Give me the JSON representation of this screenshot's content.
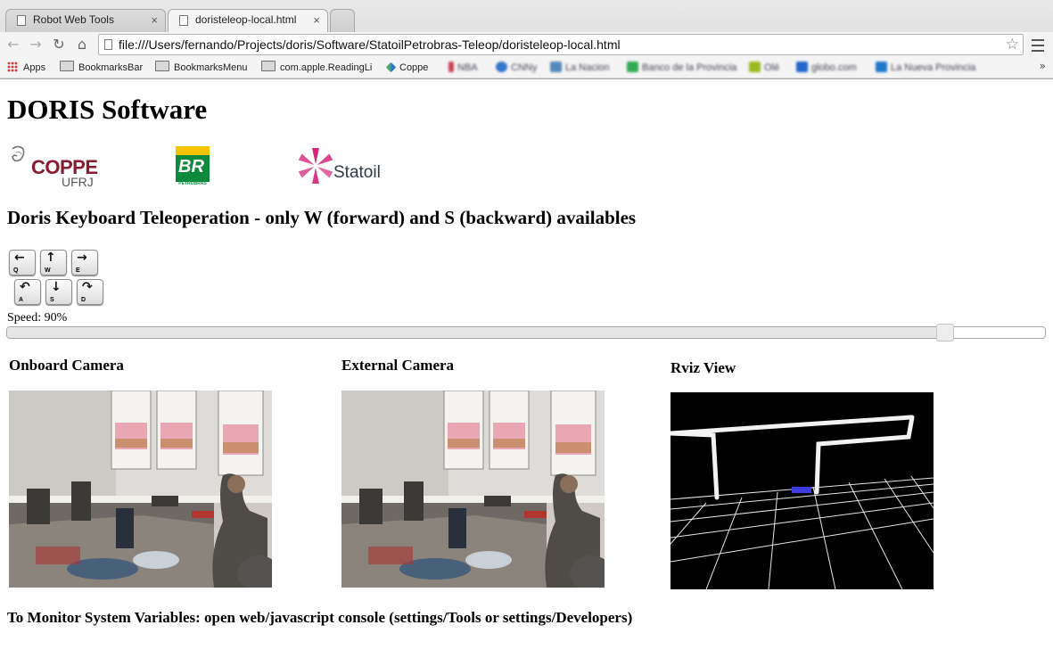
{
  "browser": {
    "tabs": [
      {
        "label": "Robot Web Tools",
        "close": "×"
      },
      {
        "label": "doristeleop-local.html",
        "close": "×"
      }
    ],
    "url": "file:///Users/fernando/Projects/doris/Software/StatoilPetrobras-Teleop/doristeleop-local.html",
    "bookmarks": [
      "Apps",
      "BookmarksBar",
      "BookmarksMenu",
      "com.apple.ReadingLi",
      "Coppe",
      "NBA",
      "CNNy",
      "La Nacion",
      "Banco de la Provincia",
      "Olé",
      "globo.com",
      "La Nueva Provincia"
    ],
    "more_glyph": "»"
  },
  "page": {
    "title": "DORIS Software",
    "logos": {
      "coppe": {
        "name": "COPPE",
        "sub": "UFRJ"
      },
      "petrobras": {
        "mark": "BR",
        "sub": "PETROBRAS"
      },
      "statoil": {
        "name": "Statoil"
      }
    },
    "teleop_heading": "Doris Keyboard Teleoperation - only W (forward) and S (backward) availables",
    "keys": [
      {
        "letter": "Q",
        "arrow": "←"
      },
      {
        "letter": "W",
        "arrow": "↑"
      },
      {
        "letter": "E",
        "arrow": "→"
      },
      {
        "letter": "A",
        "arrow": "↶"
      },
      {
        "letter": "S",
        "arrow": "↓"
      },
      {
        "letter": "D",
        "arrow": "↷"
      }
    ],
    "speed_label": "Speed: 90%",
    "speed_fraction": 0.9,
    "panels": {
      "onboard": "Onboard Camera",
      "external": "External Camera",
      "rviz": "Rviz View"
    },
    "footer": "To Monitor System Variables: open web/javascript console (settings/Tools or settings/Developers)"
  }
}
